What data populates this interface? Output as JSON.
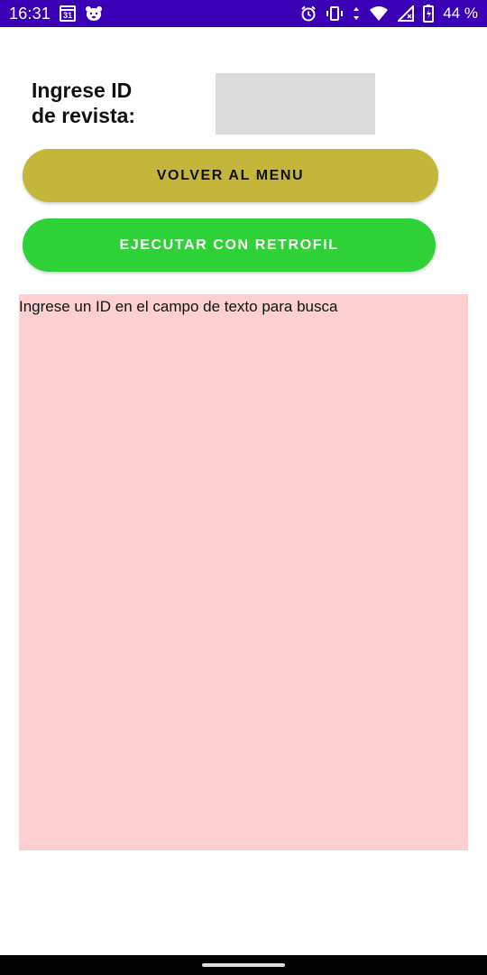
{
  "status_bar": {
    "time": "16:31",
    "calendar_day": "31",
    "battery_percent": "44 %",
    "background_color": "#3a00b5",
    "icons": [
      "calendar-icon",
      "bear-icon",
      "alarm-icon",
      "vibrate-icon",
      "data-arrows-icon",
      "wifi-icon",
      "signal-icon",
      "battery-icon"
    ]
  },
  "form": {
    "prompt_label": "Ingrese ID\nde revista:",
    "id_input_value": "",
    "id_input_placeholder": ""
  },
  "buttons": {
    "back_label": "VOLVER AL MENU",
    "back_color": "#c4b63a",
    "run_label": "EJECUTAR CON RETROFIL",
    "run_color": "#2ed136"
  },
  "result": {
    "text": "Ingrese un ID en el campo de texto para busca",
    "background_color": "#fcd0d0"
  }
}
